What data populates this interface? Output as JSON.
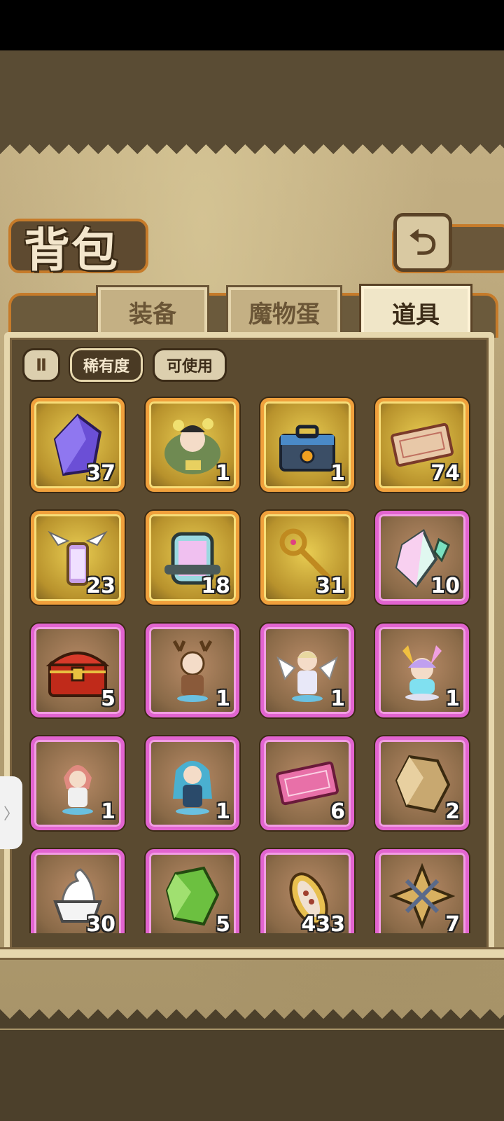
{
  "header": {
    "title": "背包",
    "back_icon": "back-arrow-icon"
  },
  "tabs": [
    {
      "label": "装备",
      "active": false
    },
    {
      "label": "魔物蛋",
      "active": false
    },
    {
      "label": "道具",
      "active": true
    }
  ],
  "filters": {
    "toggle_icon": "pause-filter-icon",
    "toggle_glyph": "Ⅱ",
    "rarity_label": "稀有度",
    "usable_label": "可使用"
  },
  "items": [
    {
      "icon": "purple-crystal-icon",
      "count": "37",
      "rarity": "gold"
    },
    {
      "icon": "flower-girl-figure-icon",
      "count": "1",
      "rarity": "gold"
    },
    {
      "icon": "toolbox-icon",
      "count": "1",
      "rarity": "gold"
    },
    {
      "icon": "ticket-icon",
      "count": "74",
      "rarity": "gold"
    },
    {
      "icon": "winged-lantern-icon",
      "count": "23",
      "rarity": "gold"
    },
    {
      "icon": "rainbow-capsule-icon",
      "count": "18",
      "rarity": "gold"
    },
    {
      "icon": "golden-key-icon",
      "count": "31",
      "rarity": "gold"
    },
    {
      "icon": "rainbow-crystal-icon",
      "count": "10",
      "rarity": "pink"
    },
    {
      "icon": "treasure-chest-icon",
      "count": "5",
      "rarity": "pink"
    },
    {
      "icon": "antler-figure-icon",
      "count": "1",
      "rarity": "pink"
    },
    {
      "icon": "angel-figure-icon",
      "count": "1",
      "rarity": "pink"
    },
    {
      "icon": "pastel-figure-icon",
      "count": "1",
      "rarity": "pink"
    },
    {
      "icon": "red-hood-figure-icon",
      "count": "1",
      "rarity": "pink"
    },
    {
      "icon": "blue-hair-figure-icon",
      "count": "1",
      "rarity": "pink"
    },
    {
      "icon": "pink-ticket-icon",
      "count": "6",
      "rarity": "pink"
    },
    {
      "icon": "gold-ore-icon",
      "count": "2",
      "rarity": "pink"
    },
    {
      "icon": "cream-bowl-icon",
      "count": "30",
      "rarity": "pink"
    },
    {
      "icon": "green-crystal-icon",
      "count": "5",
      "rarity": "pink"
    },
    {
      "icon": "seed-pod-icon",
      "count": "433",
      "rarity": "pink"
    },
    {
      "icon": "star-compass-icon",
      "count": "7",
      "rarity": "pink"
    }
  ],
  "colors": {
    "gold_frame": "#f0a03c",
    "pink_frame": "#e264d0",
    "panel_border": "#e6d7ad"
  },
  "side_handle_glyph": "〉"
}
